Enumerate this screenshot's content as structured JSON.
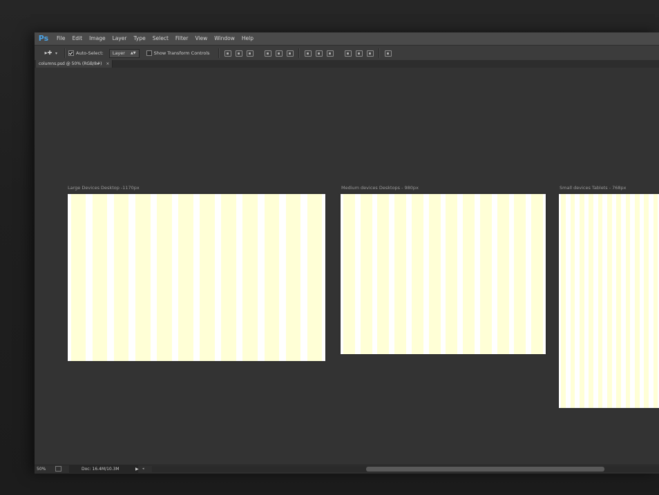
{
  "app": {
    "logo": "Ps",
    "menu": [
      "File",
      "Edit",
      "Image",
      "Layer",
      "Type",
      "Select",
      "Filter",
      "View",
      "Window",
      "Help"
    ]
  },
  "options_bar": {
    "tool_icon": "move-tool-icon",
    "auto_select_label": "Auto-Select:",
    "auto_select_checked": true,
    "auto_select_target": "Layer",
    "show_transform_label": "Show Transform Controls",
    "show_transform_checked": false
  },
  "document_tab": {
    "title": "columns.psd @ 50% (RGB/8#)",
    "close_glyph": "×"
  },
  "artboards": [
    {
      "label": "Large Devices Desktop -1170px",
      "columns": 12
    },
    {
      "label": "Medium devices Desktops - 980px",
      "columns": 12
    },
    {
      "label": "Small devices Tablets - 768px",
      "columns": 12
    }
  ],
  "colors": {
    "column": "#ffffd6",
    "gutter": "#ffffff",
    "canvas": "#333333",
    "accent": "#4aa3e6"
  },
  "status_bar": {
    "zoom": "50%",
    "doc_info": "Doc: 16.4M/10.3M",
    "arrow": "▶",
    "arrow2": "◂"
  }
}
